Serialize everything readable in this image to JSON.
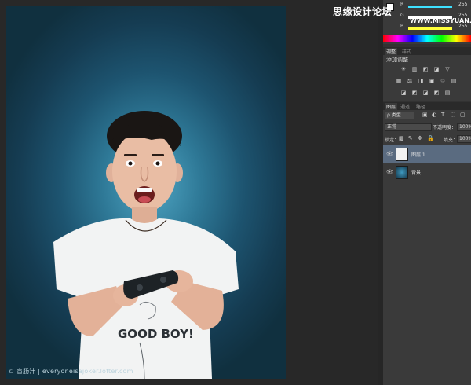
{
  "watermark": "© 盲肠汁 | everyoneisajoker.lofter.com",
  "site_overlay": {
    "cn": "思缘设计论坛",
    "en": "WWW.MISSYUAN.COM"
  },
  "color_panel": {
    "sliders": [
      {
        "label": "R",
        "value": "255",
        "color": "#3ee0ff"
      },
      {
        "label": "G",
        "value": "255",
        "color": "#ffffff"
      },
      {
        "label": "B",
        "value": "255",
        "color": "#ffff3a"
      }
    ]
  },
  "adjust_panel": {
    "tabs": [
      "调整",
      "样式"
    ],
    "title": "添加调整",
    "icons": [
      [
        "☀",
        "▥",
        "◩",
        "◪",
        "▽"
      ],
      [
        "▦",
        "⚖",
        "◨",
        "▣",
        "♲",
        "▤"
      ],
      [
        "◪",
        "◩",
        "◪",
        "◩",
        "▤"
      ]
    ]
  },
  "layers_panel": {
    "tabs": [
      "图层",
      "通道",
      "路径"
    ],
    "filter_label": "ρ 类型",
    "blend_mode": "正常",
    "opacity_label": "不透明度：",
    "opacity_value": "100%",
    "lock_label": "锁定：",
    "fill_label": "填充：",
    "fill_value": "100%",
    "layers": [
      {
        "name": "图层 1",
        "selected": true
      },
      {
        "name": "背景",
        "selected": false
      }
    ]
  }
}
